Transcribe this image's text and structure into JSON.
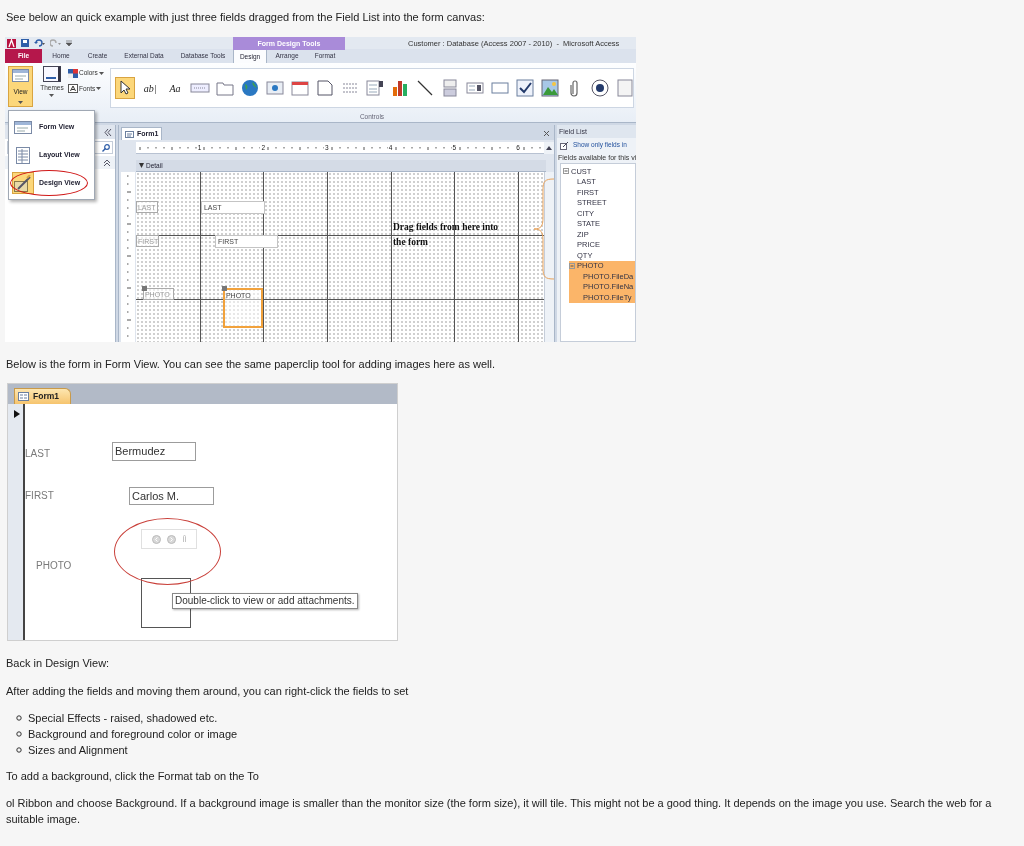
{
  "intro": "See below an quick example with just three fields dragged from the Field List into the form canvas:",
  "design_view_window": {
    "contextual_tab": "Form Design Tools",
    "title": "Customer : Database (Access 2007 - 2010)  -  Microsoft Access",
    "ribbon_tabs": [
      {
        "label": "File",
        "kind": "file",
        "selected": false
      },
      {
        "label": "Home",
        "kind": "tab",
        "selected": false
      },
      {
        "label": "Create",
        "kind": "tab",
        "selected": false
      },
      {
        "label": "External Data",
        "kind": "tab",
        "selected": false
      },
      {
        "label": "Database Tools",
        "kind": "tab",
        "selected": false
      },
      {
        "label": "Design",
        "kind": "tab",
        "selected": true
      },
      {
        "label": "Arrange",
        "kind": "tab",
        "selected": false
      },
      {
        "label": "Format",
        "kind": "tab",
        "selected": false
      }
    ],
    "view_button": "View",
    "themes_button": "Themes",
    "colors_button": "Colors",
    "fonts_button": "Fonts",
    "controls": [
      {
        "kind": "pointer",
        "selected": true
      },
      {
        "kind": "glyph",
        "text": "ab|",
        "selected": false
      },
      {
        "kind": "glyph",
        "text": "Aa",
        "selected": false
      },
      {
        "kind": "button",
        "selected": false
      },
      {
        "kind": "tab",
        "selected": false
      },
      {
        "kind": "globe",
        "selected": false
      },
      {
        "kind": "navigation",
        "selected": false
      },
      {
        "kind": "browser",
        "selected": false
      },
      {
        "kind": "frame",
        "selected": false
      },
      {
        "kind": "pagebreak",
        "selected": false
      },
      {
        "kind": "combo",
        "selected": false
      },
      {
        "kind": "chart",
        "selected": false
      },
      {
        "kind": "line",
        "selected": false
      },
      {
        "kind": "toggle",
        "selected": false
      },
      {
        "kind": "listbox",
        "selected": false
      },
      {
        "kind": "rectangle",
        "selected": false
      },
      {
        "kind": "checkbox",
        "selected": false
      },
      {
        "kind": "image",
        "selected": false
      },
      {
        "kind": "paperclip",
        "selected": false
      },
      {
        "kind": "radio",
        "selected": false
      },
      {
        "kind": "subform",
        "selected": false
      }
    ],
    "controls_group_label": "Controls",
    "view_menu": [
      {
        "label": "Form View",
        "kind": "form",
        "selected": false
      },
      {
        "label": "Layout View",
        "kind": "layout",
        "selected": false
      },
      {
        "label": "Design View",
        "kind": "design",
        "selected": true
      }
    ],
    "form_tab": "Form1",
    "ruler_marks": [
      "1",
      "2",
      "3",
      "4",
      "5",
      "6"
    ],
    "section": "Detail",
    "form_controls": [
      {
        "kind": "label",
        "text": "LAST",
        "selected": false
      },
      {
        "kind": "textbox",
        "text": "LAST",
        "selected": false
      },
      {
        "kind": "label",
        "text": "FIRST",
        "selected": false
      },
      {
        "kind": "textbox",
        "text": "FIRST",
        "selected": false
      },
      {
        "kind": "label",
        "text": "PHOTO",
        "selected": true
      },
      {
        "kind": "attachment",
        "text": "PHOTO",
        "selected": true
      }
    ],
    "callout": "Drag fields from here into the form",
    "field_list": {
      "title": "Field List",
      "link": "Show only fields in",
      "caption": "Fields available for this vi",
      "tree": [
        {
          "label": "CUST",
          "expanded": true,
          "selected": false,
          "children": [
            {
              "label": "LAST",
              "selected": false
            },
            {
              "label": "FIRST",
              "selected": false
            },
            {
              "label": "STREET",
              "selected": false
            },
            {
              "label": "CITY",
              "selected": false
            },
            {
              "label": "STATE",
              "selected": false
            },
            {
              "label": "ZIP",
              "selected": false
            },
            {
              "label": "PRICE",
              "selected": false
            },
            {
              "label": "QTY",
              "selected": false
            },
            {
              "label": "PHOTO",
              "expanded": true,
              "selected": true,
              "children": [
                {
                  "label": "PHOTO.FileDa",
                  "selected": true
                },
                {
                  "label": "PHOTO.FileNa",
                  "selected": true
                },
                {
                  "label": "PHOTO.FileTy",
                  "selected": true
                }
              ]
            }
          ]
        }
      ]
    }
  },
  "form_view_caption": "Below is the form in Form View. You can see the same paperclip tool for adding images here as well.",
  "form_view_window": {
    "form_tab": "Form1",
    "fields": [
      {
        "kind": "text",
        "label": "LAST",
        "value": "Bermudez"
      },
      {
        "kind": "text",
        "label": "FIRST",
        "value": "Carlos M."
      },
      {
        "kind": "attachment",
        "label": "PHOTO"
      }
    ],
    "tooltip": "Double-click to view or add attachments."
  },
  "paragraphs_before_list": [
    "Back in Design View:",
    "After adding the fields and moving them around, you can right-click the fields to set"
  ],
  "bullets": [
    "Special Effects - raised, shadowed etc.",
    "Background and foreground color or image",
    "Sizes and Alignment"
  ],
  "paragraphs_after_list": [
    "To add a background, click the Format tab on the To",
    "ol Ribbon and choose Background. If a background image is smaller than the monitor size (the form size), it will tile. This might not be a good thing. It depends on the image you use. Search the web for a suitable image."
  ]
}
